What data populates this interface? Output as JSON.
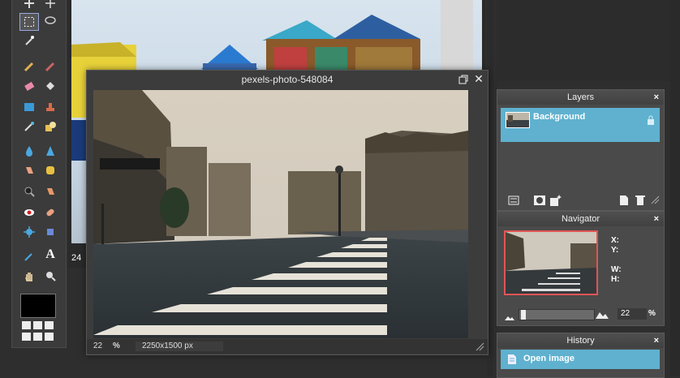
{
  "document": {
    "title": "pexels-photo-548084",
    "zoom": "22",
    "zoom_unit": "%",
    "size": "2250x1500 px"
  },
  "background_document": {
    "zoom": "24"
  },
  "layers_panel": {
    "title": "Layers",
    "close": "×",
    "layers": [
      {
        "name": "Background",
        "locked": true
      }
    ]
  },
  "navigator_panel": {
    "title": "Navigator",
    "close": "×",
    "x_label": "X:",
    "y_label": "Y:",
    "w_label": "W:",
    "h_label": "H:",
    "zoom": "22",
    "zoom_unit": "%"
  },
  "history_panel": {
    "title": "History",
    "close": "×",
    "items": [
      "Open image"
    ]
  },
  "colors": {
    "accent": "#5fb1cf",
    "panel_bg": "#4a4a4a",
    "foreground_color": "#000000"
  },
  "tools": [
    "move-icon",
    "marquee-icon",
    "lasso-icon",
    "magic-wand-icon",
    "pencil-icon",
    "brush-icon",
    "eraser-icon",
    "paint-bucket-icon",
    "gradient-icon",
    "clone-stamp-icon",
    "color-replace-icon",
    "drawing-icon",
    "blur-icon",
    "sharpen-icon",
    "smudge-icon",
    "sponge-icon",
    "burn-icon",
    "dodge-icon",
    "red-eye-icon",
    "spot-heal-icon",
    "bloat-icon",
    "pinch-icon",
    "color-picker-icon",
    "type-icon",
    "hand-icon",
    "zoom-icon"
  ]
}
